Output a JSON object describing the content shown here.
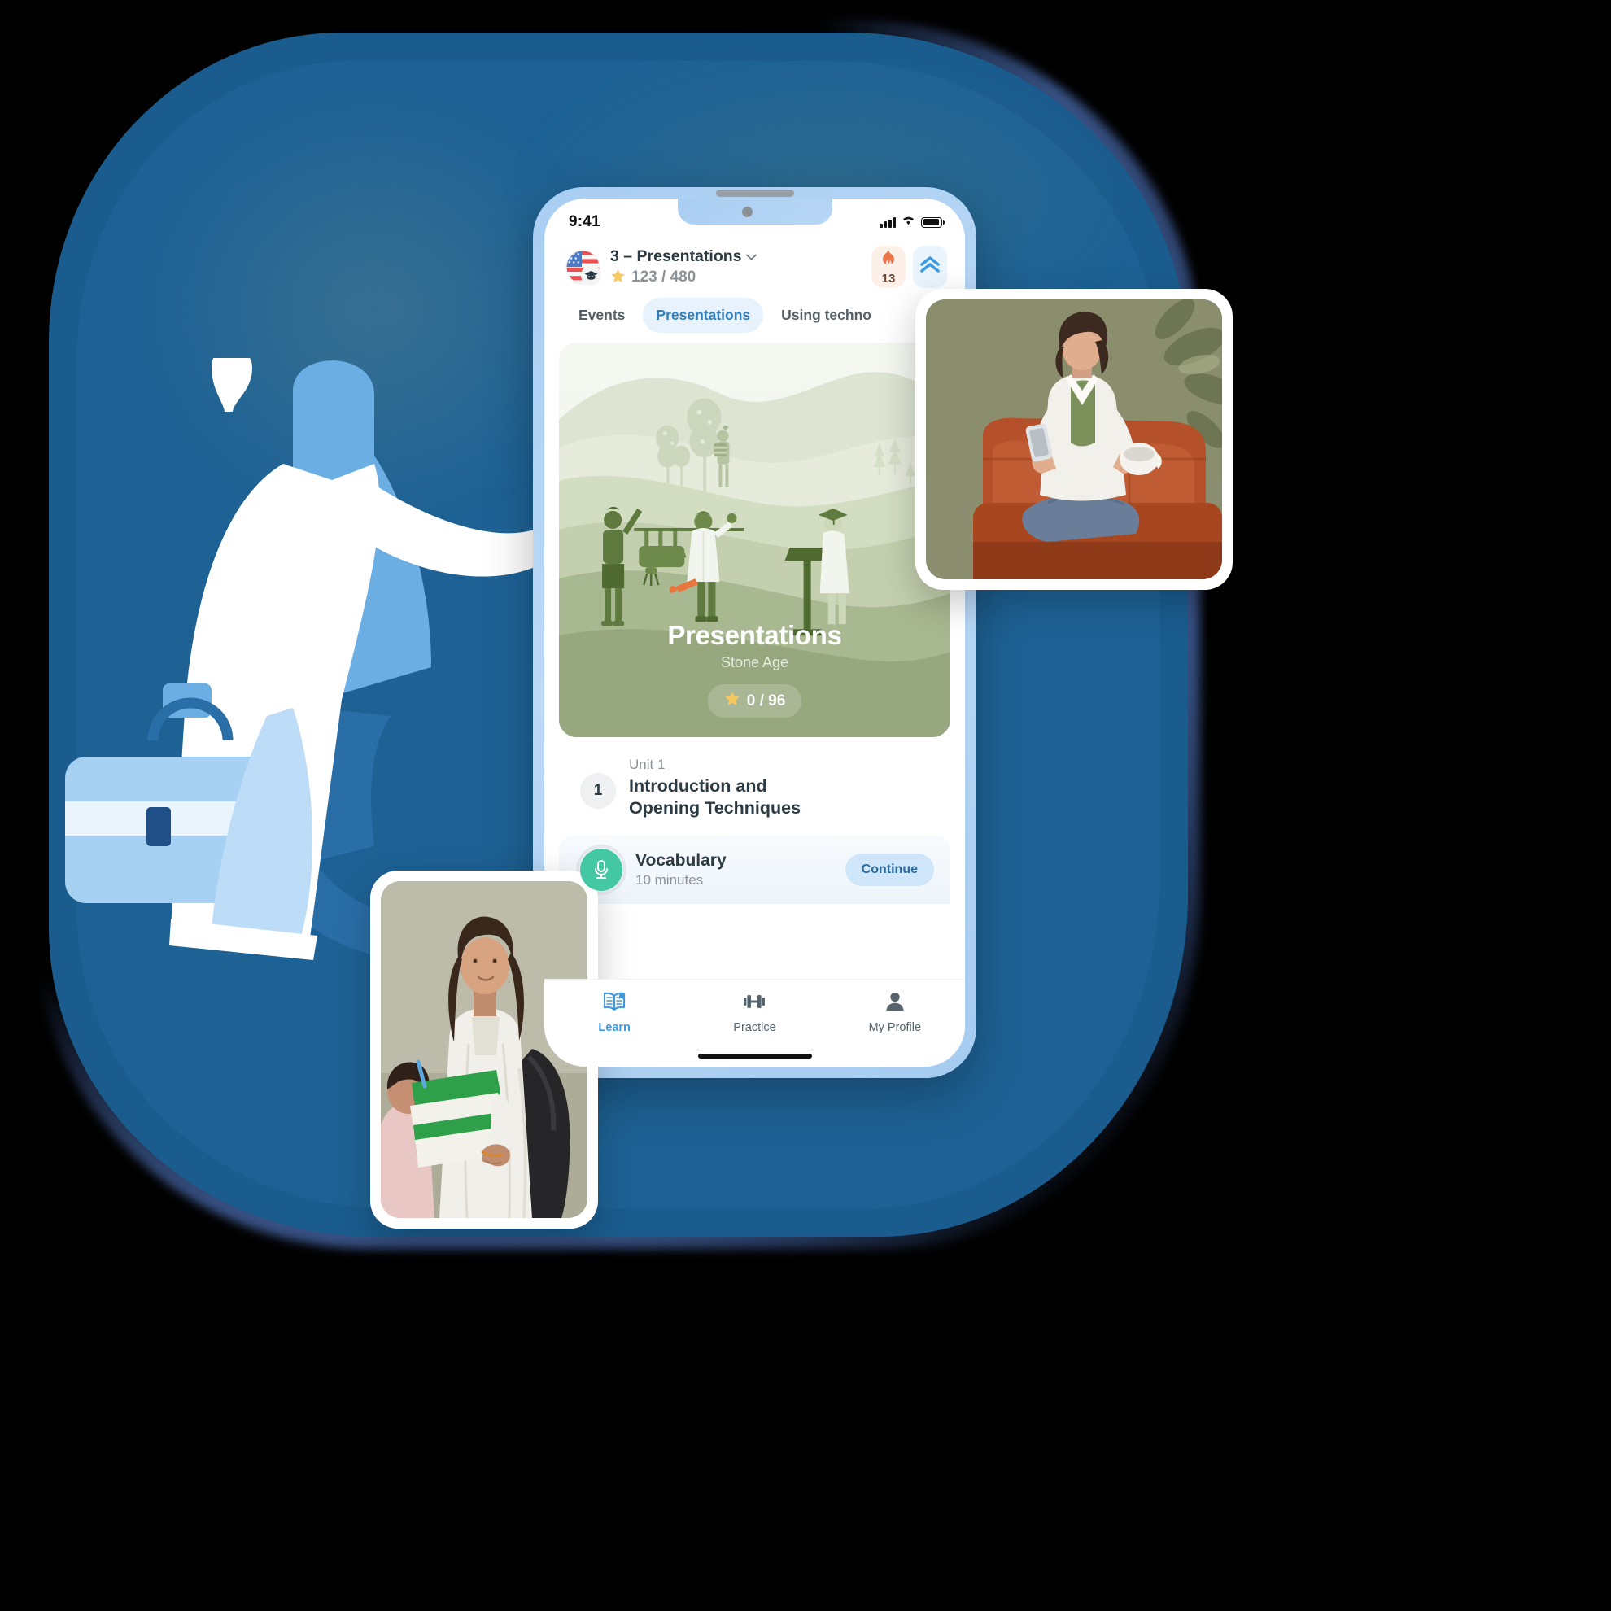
{
  "meta": {
    "app_kind": "language-learning-mobile-app",
    "brand_blue": "#3f9ae0",
    "accent_green": "#44c8a4",
    "hero_green": "#77885f",
    "streak_bg": "#fdf0e9",
    "level_bg": "#eaf4fd"
  },
  "status_bar": {
    "time": "9:41",
    "icons": [
      "cellular-signal-icon",
      "wifi-icon",
      "battery-icon"
    ]
  },
  "course_header": {
    "avatar_icon": "us-flag-graduation-cap-icon",
    "title": "3 – Presentations",
    "dropdown_icon": "chevron-down-icon",
    "xp_star_icon": "star-icon",
    "xp_value": "123 / 480",
    "streak": {
      "icon": "flame-icon",
      "count": "13"
    },
    "level": {
      "icon": "double-chevron-up-icon"
    }
  },
  "tabs": [
    {
      "label": "Events",
      "active": false
    },
    {
      "label": "Presentations",
      "active": true
    },
    {
      "label": "Using techno",
      "active": false
    }
  ],
  "hero_card": {
    "illustration": "stone-age-presentation-illustration",
    "title": "Presentations",
    "subtitle": "Stone Age",
    "xp_star_icon": "star-icon",
    "xp_value": "0 / 96"
  },
  "unit": {
    "number": "1",
    "label": "Unit 1",
    "title": "Introduction and\nOpening Techniques"
  },
  "lesson": {
    "icon": "microphone-icon",
    "title": "Vocabulary",
    "duration": "10 minutes",
    "action_label": "Continue"
  },
  "bottom_nav": [
    {
      "label": "Learn",
      "icon": "open-book-icon",
      "active": true
    },
    {
      "label": "Practice",
      "icon": "dumbbell-icon",
      "active": false
    },
    {
      "label": "My Profile",
      "icon": "person-icon",
      "active": false
    }
  ],
  "photos": [
    {
      "name": "woman-on-couch-with-phone-photo"
    },
    {
      "name": "student-with-notebook-and-backpack-photo"
    }
  ],
  "illustration": {
    "name": "person-with-briefcase-illustration"
  }
}
